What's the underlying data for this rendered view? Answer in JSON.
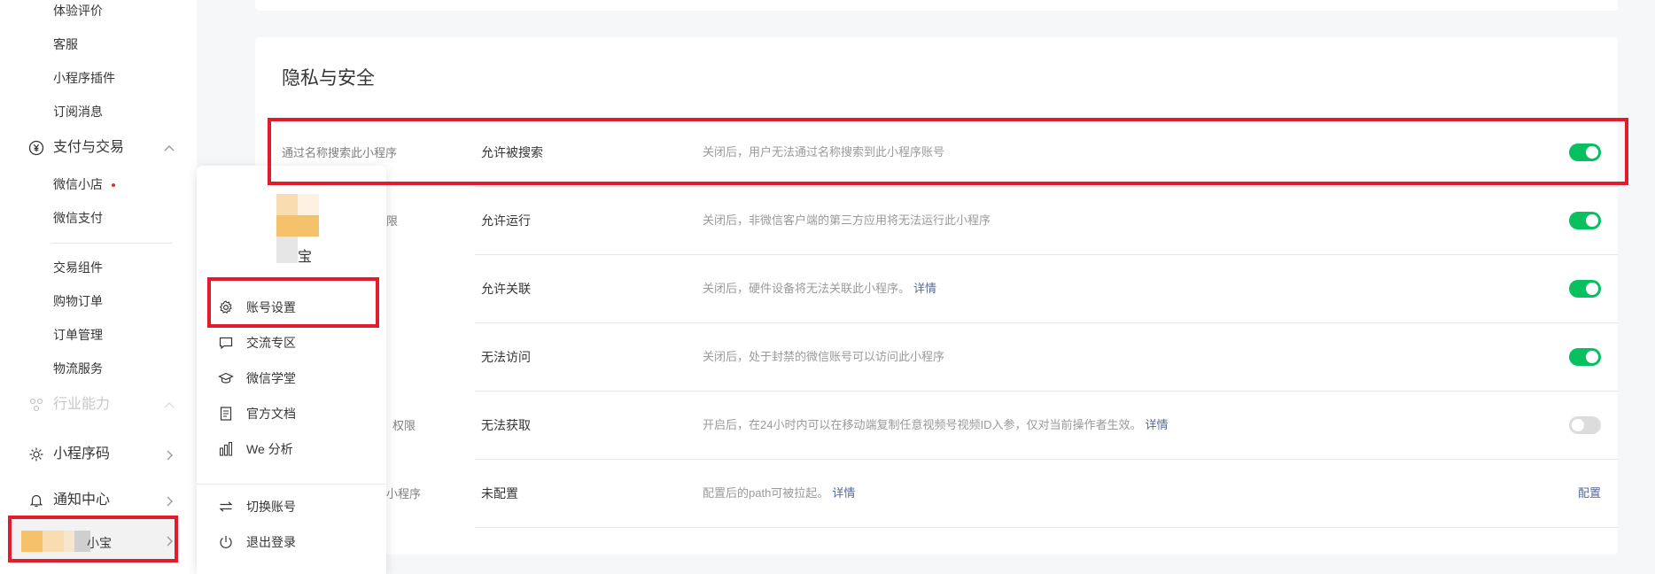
{
  "sidebar": {
    "sub_top": [
      {
        "label": "体验评价"
      },
      {
        "label": "客服"
      },
      {
        "label": "小程序插件"
      },
      {
        "label": "订阅消息"
      }
    ],
    "pay_group": {
      "label": "支付与交易",
      "icon": "yen-circle-icon"
    },
    "pay_sub": [
      {
        "label": "微信小店",
        "badge": true
      },
      {
        "label": "微信支付"
      }
    ],
    "trade_sub": [
      {
        "label": "交易组件"
      },
      {
        "label": "购物订单"
      },
      {
        "label": "订单管理"
      },
      {
        "label": "物流服务"
      }
    ],
    "industry_group": {
      "label": "行业能力"
    },
    "qrcode_group": {
      "label": "小程序码"
    },
    "notify_group": {
      "label": "通知中心"
    },
    "user_name_tail": "小宝"
  },
  "card": {
    "title": "隐私与安全",
    "rows": [
      {
        "label": "通过名称搜索此小程序",
        "value": "允许被搜索",
        "desc": "关闭后，用户无法通过名称搜索到此小程序账号",
        "link": "",
        "control": "toggle",
        "on": true
      },
      {
        "label": "限",
        "value": "允许运行",
        "desc": "关闭后，非微信客户端的第三方应用将无法运行此小程序",
        "link": "",
        "control": "toggle",
        "on": true
      },
      {
        "label": "",
        "value": "允许关联",
        "desc": "关闭后，硬件设备将无法关联此小程序。",
        "link": "详情",
        "control": "toggle",
        "on": true
      },
      {
        "label": "",
        "value": "无法访问",
        "desc": "关闭后，处于封禁的微信账号可以访问此小程序",
        "link": "",
        "control": "toggle",
        "on": true
      },
      {
        "label": "权限",
        "value": "无法获取",
        "desc": "开启后，在24小时内可以在移动端复制任意视频号视频ID入参，仅对当前操作者生效。",
        "link": "详情",
        "control": "toggle",
        "on": false
      },
      {
        "label": "小程序",
        "value": "未配置",
        "desc": "配置后的path可被拉起。",
        "link": "详情",
        "control": "link",
        "action_label": "配置"
      }
    ]
  },
  "popup": {
    "user_name": "宝",
    "items": [
      {
        "label": "账号设置",
        "icon": "gear-icon"
      },
      {
        "label": "交流专区",
        "icon": "chat-bubble-icon"
      },
      {
        "label": "微信学堂",
        "icon": "graduation-cap-icon"
      },
      {
        "label": "官方文档",
        "icon": "document-icon"
      },
      {
        "label": "We 分析",
        "icon": "analytics-bars-icon"
      },
      {
        "label": "切换账号",
        "icon": "switch-arrows-icon"
      },
      {
        "label": "退出登录",
        "icon": "power-icon"
      }
    ]
  },
  "colors": {
    "accent_green": "#07c160",
    "link_blue": "#576b95",
    "highlight_red": "#e21c2c"
  }
}
